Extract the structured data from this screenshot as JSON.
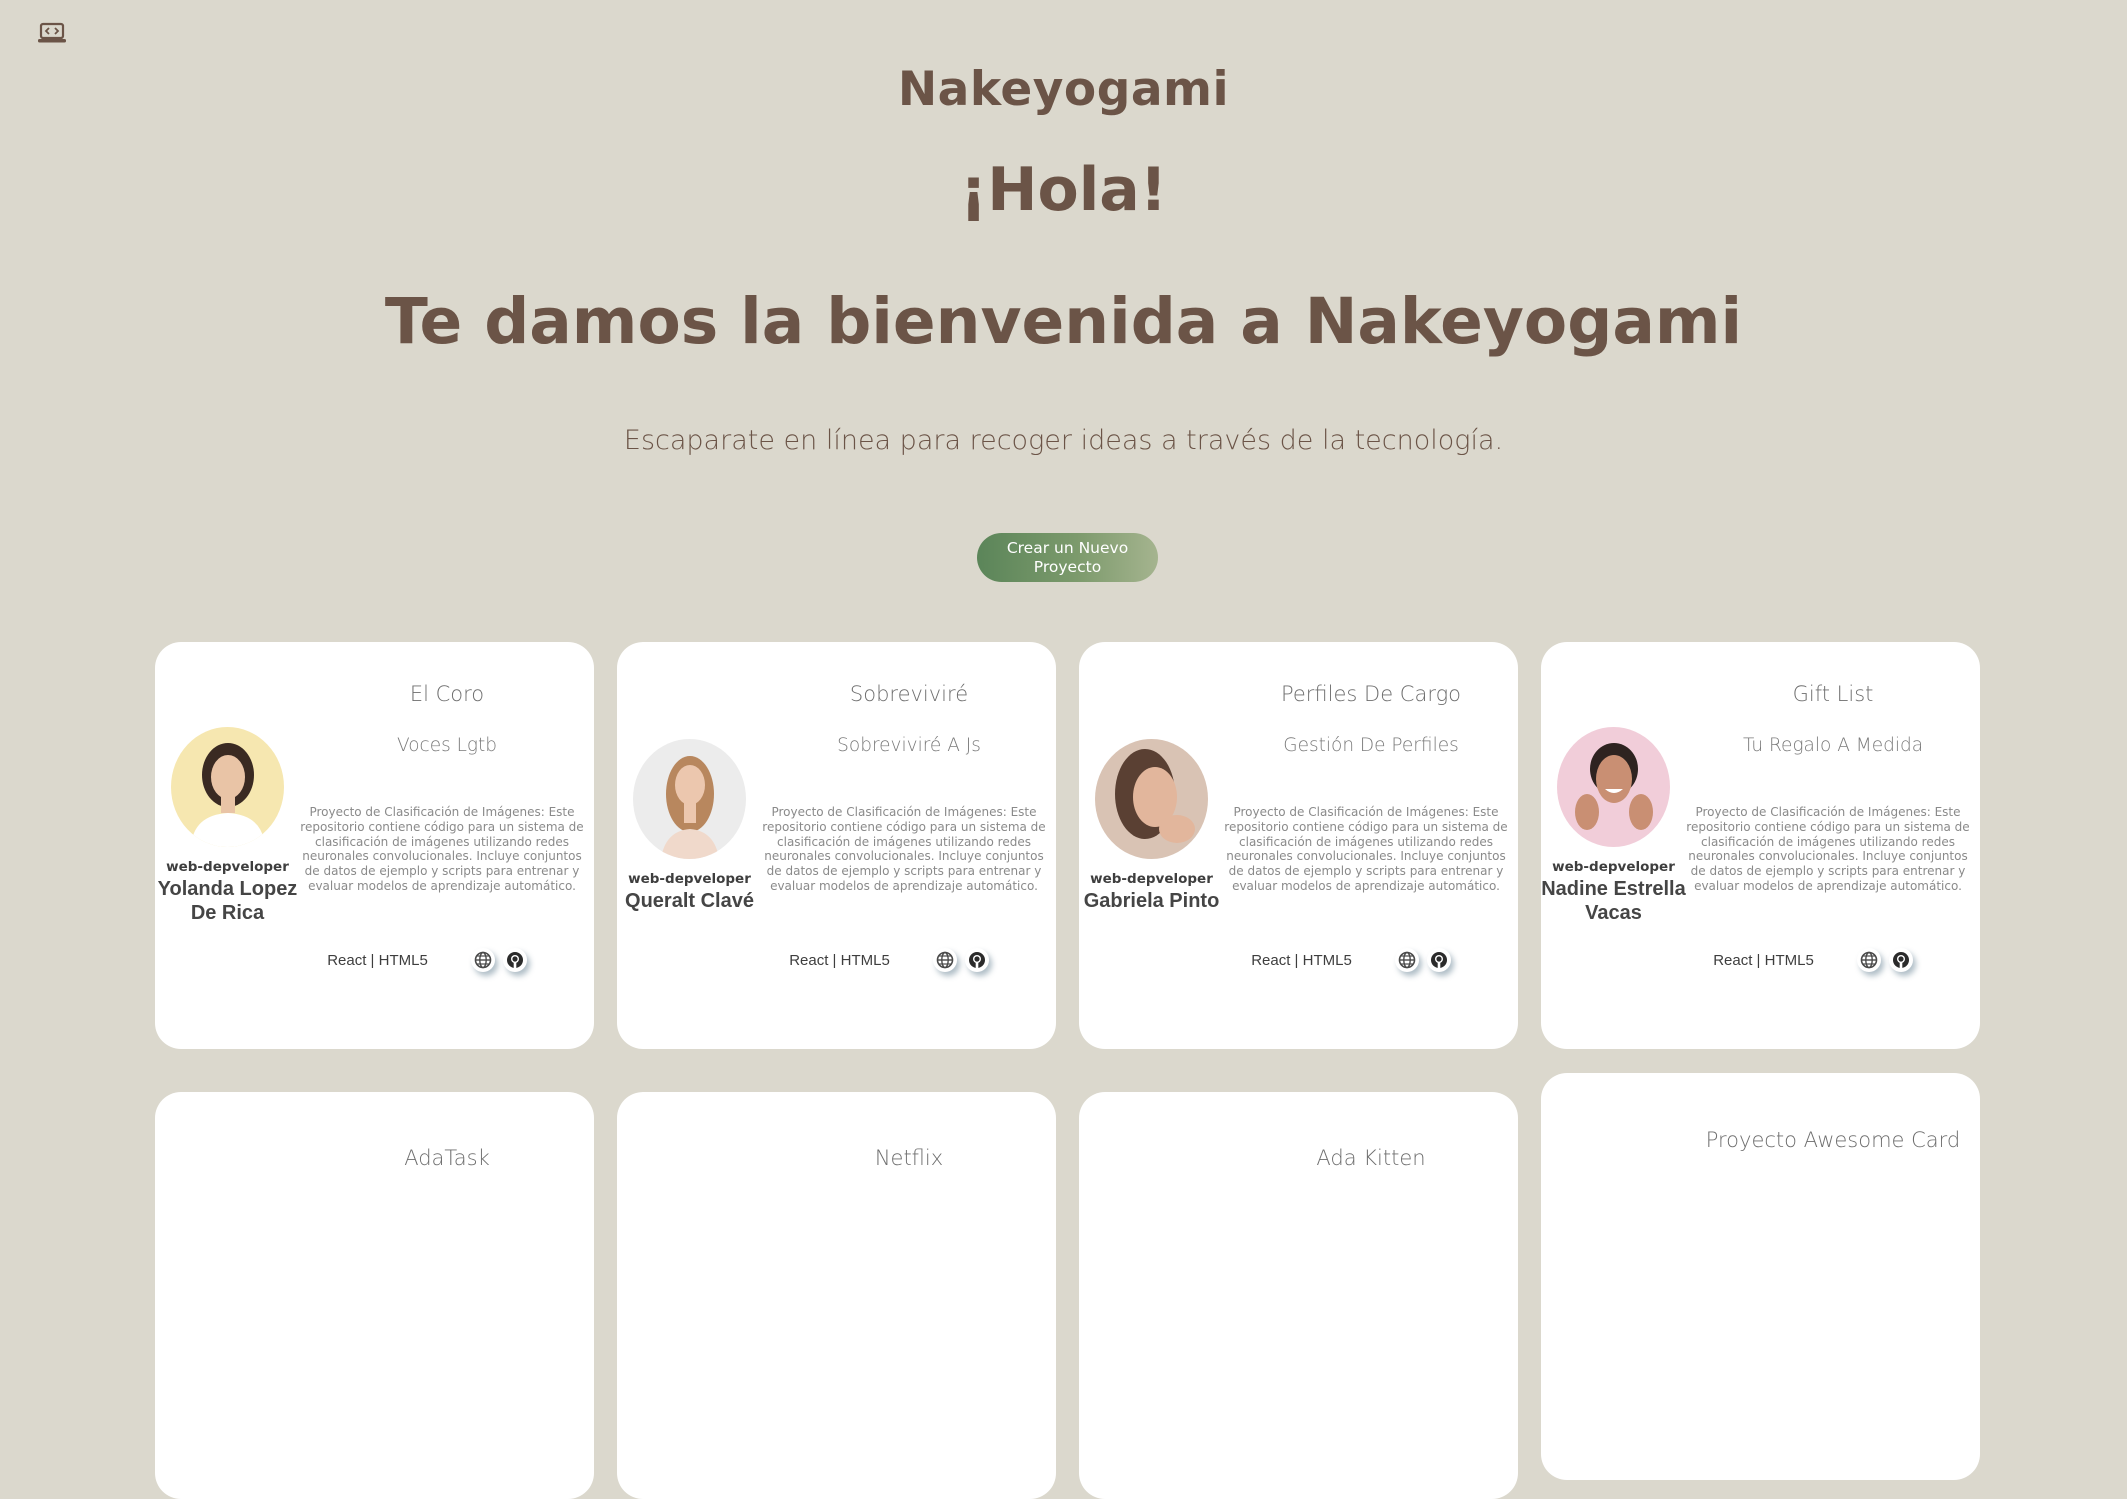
{
  "header": {
    "brand": "Nakeyogami",
    "greeting": "¡Hola!",
    "welcome": "Te damos la bienvenida a Nakeyogami",
    "tagline": "Escaparate en línea para recoger ideas a través de la tecnología.",
    "new_project_button": "Crear un Nuevo Proyecto"
  },
  "nav": {
    "home_icon": "laptop-code-icon"
  },
  "colors": {
    "background": "#dbd8cd",
    "brand_text": "#6b5447",
    "button_gradient_start": "#5b8559",
    "button_gradient_end": "#a5b48f",
    "card_background": "#ffffff"
  },
  "cards": [
    {
      "role": "web-depveloper",
      "author": "Yolanda Lopez De Rica",
      "name": "El Coro",
      "slogan": "Voces Lgtb",
      "desc": "Proyecto de Clasificación de Imágenes: Este repositorio contiene código para un sistema de clasificación de imágenes utilizando redes neuronales convolucionales. Incluye conjuntos de datos de ejemplo y scripts para entrenar y evaluar modelos de aprendizaje automático.",
      "technologies": "React | HTML5",
      "avatar_bg": "#f6e7b0"
    },
    {
      "role": "web-depveloper",
      "author": "Queralt Clavé",
      "name": "Sobreviviré",
      "slogan": "Sobreviviré A Js",
      "desc": "Proyecto de Clasificación de Imágenes: Este repositorio contiene código para un sistema de clasificación de imágenes utilizando redes neuronales convolucionales. Incluye conjuntos de datos de ejemplo y scripts para entrenar y evaluar modelos de aprendizaje automático.",
      "technologies": "React | HTML5",
      "avatar_bg": "#ececec"
    },
    {
      "role": "web-depveloper",
      "author": "Gabriela Pinto",
      "name": "Perfiles De Cargo",
      "slogan": "Gestión De Perfiles",
      "desc": "Proyecto de Clasificación de Imágenes: Este repositorio contiene código para un sistema de clasificación de imágenes utilizando redes neuronales convolucionales. Incluye conjuntos de datos de ejemplo y scripts para entrenar y evaluar modelos de aprendizaje automático.",
      "technologies": "React | HTML5",
      "avatar_bg": "#d9c3b4"
    },
    {
      "role": "web-depveloper",
      "author": "Nadine Estrella Vacas",
      "name": "Gift List",
      "slogan": "Tu Regalo A Medida",
      "desc": "Proyecto de Clasificación de Imágenes: Este repositorio contiene código para un sistema de clasificación de imágenes utilizando redes neuronales convolucionales. Incluye conjuntos de datos de ejemplo y scripts para entrenar y evaluar modelos de aprendizaje automático.",
      "technologies": "React | HTML5",
      "avatar_bg": "#f1cdd9"
    }
  ],
  "lower_cards": [
    {
      "name": "AdaTask"
    },
    {
      "name": "Netflix"
    },
    {
      "name": "Ada Kitten"
    },
    {
      "name": "Proyecto Awesome Card"
    }
  ]
}
